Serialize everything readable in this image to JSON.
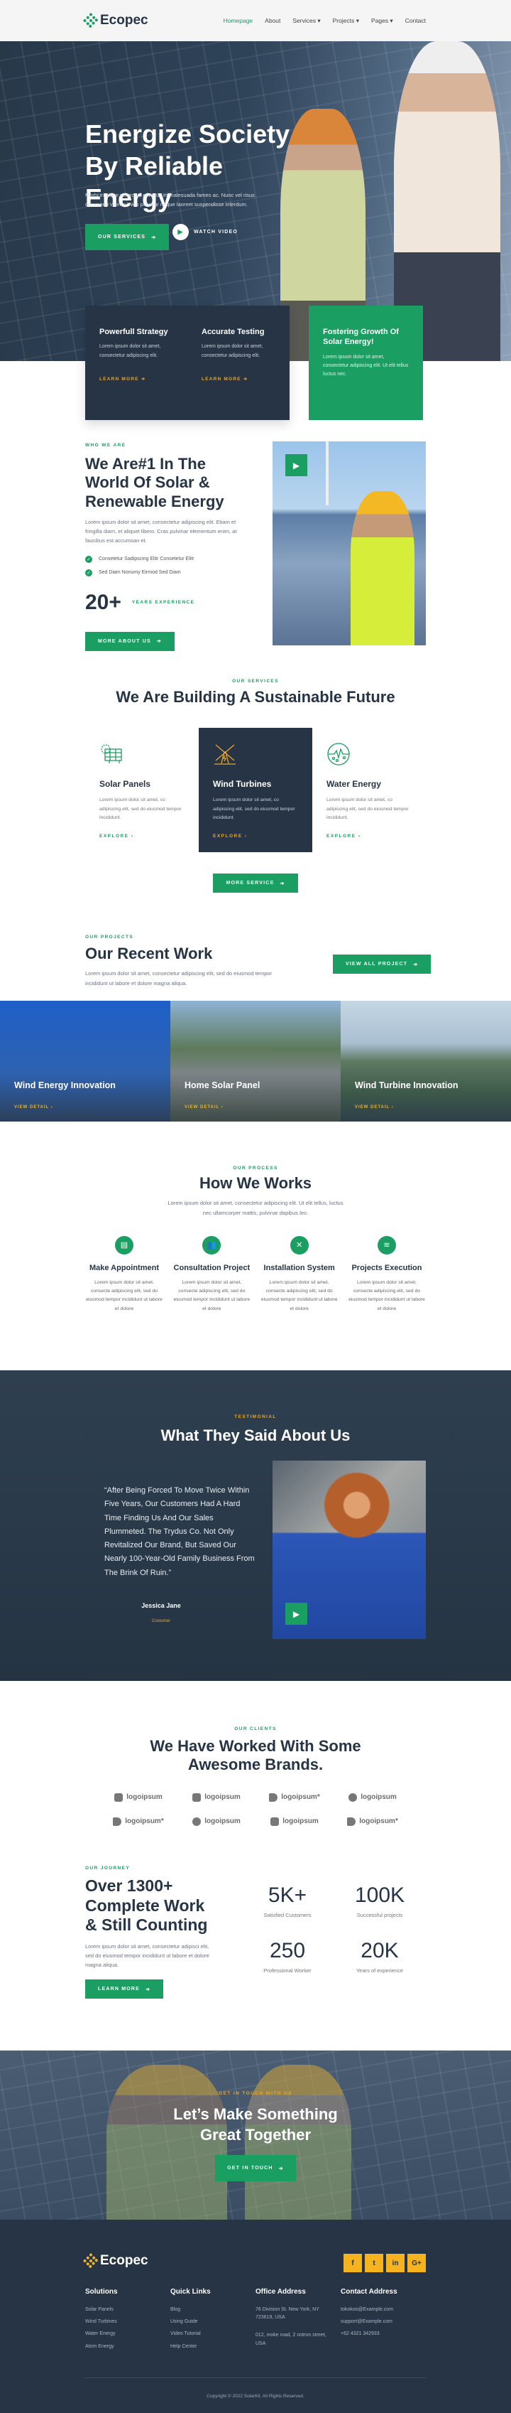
{
  "brand": "Ecopec",
  "colors": {
    "accent": "#1a9e62",
    "dark": "#263445",
    "highlight": "#f0b429"
  },
  "nav": {
    "items": [
      {
        "label": "Homepage",
        "active": true
      },
      {
        "label": "About"
      },
      {
        "label": "Services ▾"
      },
      {
        "label": "Projects ▾"
      },
      {
        "label": "Pages ▾"
      },
      {
        "label": "Contact"
      }
    ]
  },
  "hero": {
    "title": "Energize Society By Reliable Energy",
    "description": "Morbi tristique senectus et netus et malesuada fames ac. Nunc vel risus commodo viverra. Non pulvinar neque laoreet suspendisse interdum.",
    "services_button": "Our Services",
    "watch_video": "Watch Video"
  },
  "features": [
    {
      "title": "Powerfull Strategy",
      "text": "Lorem ipsum dolor sit amet, consectetur adipiscing elit.",
      "link": "Learn More"
    },
    {
      "title": "Accurate Testing",
      "text": "Lorem ipsum dolor sit amet, consectetur adipiscing elit.",
      "link": "Learn More"
    },
    {
      "title": "Fostering Growth Of Solar Energy!",
      "text": "Lorem ipsum dolor sit amet, consectetur adipiscing elit. Ut elit tellus luctus nec."
    }
  ],
  "about": {
    "eyebrow": "Who We Are",
    "title": "We Are#1 In The World Of Solar & Renewable Energy",
    "text": "Lorem ipsum dolor sit amet, consectetur adipiscing elit. Etiam et fringilla diam, et aliquet libero. Cras pulvinar elementum enim, at faucibus est accumsan et.",
    "checks": [
      "Consetetur Sadipscing Elitr Consetetur Elitr",
      "Sed Diam Nonumy Eirmod Sed Diam"
    ],
    "years": "20+",
    "years_label": "Years Experience",
    "button": "More About Us"
  },
  "services": {
    "eyebrow": "Our Services",
    "title": "We Are Building A Sustainable Future",
    "items": [
      {
        "icon": "solar-panel-icon",
        "title": "Solar Panels",
        "text": "Lorem ipsum dolor sit amet, co adipiscing elit, sed do eiusmod tempor incididunt.",
        "link": "Explore"
      },
      {
        "icon": "windmill-icon",
        "title": "Wind Turbines",
        "text": "Lorem ipsum dolor sit amet, co adipiscing elit, sed do eiusmod tempor incididunt.",
        "link": "Explore"
      },
      {
        "icon": "water-energy-icon",
        "title": "Water Energy",
        "text": "Lorem ipsum dolor sit amet, co adipiscing elit, sed do eiusmod tempor incididunt.",
        "link": "Explore"
      }
    ],
    "button": "More Service"
  },
  "projects": {
    "eyebrow": "Our Projects",
    "title": "Our Recent Work",
    "text": "Lorem ipsum dolor sit amet, consectetur adipiscing elit, sed do eiusmod tempor incididunt ut labore et dolore magna aliqua.",
    "button": "View All Project",
    "items": [
      {
        "title": "Wind Energy Innovation",
        "link": "View Detail"
      },
      {
        "title": "Home Solar Panel",
        "link": "View Detail"
      },
      {
        "title": "Wind Turbine Innovation",
        "link": "View Detail"
      }
    ]
  },
  "process": {
    "eyebrow": "Our Process",
    "title": "How We Works",
    "text": "Lorem ipsum dolor sit amet, consectetur adipiscing elit. Ut elit tellus, luctus nec ullamcorper mattis, pulvinar dapibus leo.",
    "steps": [
      {
        "icon": "book-icon",
        "title": "Make Appointment",
        "text": "Lorem ipsum dolor sit amet, consecte adipiscing elit, sed do eiusmod tempor incididunt ut labore et dolore"
      },
      {
        "icon": "users-icon",
        "title": "Consultation Project",
        "text": "Lorem ipsum dolor sit amet, consecte adipiscing elit, sed do eiusmod tempor incididunt ut labore et dolore"
      },
      {
        "icon": "tools-icon",
        "title": "Installation System",
        "text": "Lorem ipsum dolor sit amet, consecte adipiscing elit, sed do eiusmod tempor incididunt ut labore et dolore"
      },
      {
        "icon": "wind-icon",
        "title": "Projects Execution",
        "text": "Lorem ipsum dolor sit amet, consecte adipiscing elit, sed do eiusmod tempor incididunt ut labore et dolore"
      }
    ]
  },
  "testimonial": {
    "eyebrow": "Testimonial",
    "title": "What They Said About Us",
    "quote": "“After Being Forced To Move Twice Within Five Years, Our Customers Had A Hard Time Finding Us And Our Sales Plummeted. The Trydus Co. Not Only Revitalized Our Brand, But Saved Our Nearly 100-Year-Old Family Business From The Brink Of Ruin.”",
    "name": "Jessica Jane",
    "role": "Costumer"
  },
  "clients": {
    "eyebrow": "Our Clients",
    "title": "We Have Worked With Some Awesome Brands.",
    "logos": [
      "logoipsum",
      "logoipsum",
      "logoipsum*",
      "logoipsum",
      "logoipsum*",
      "logoipsum",
      "logoipsum",
      "logoipsum*"
    ]
  },
  "journey": {
    "eyebrow": "Our Journey",
    "title": "Over 1300+ Complete Work & Still Counting",
    "text": "Lorem ipsum dolor sit amet, consectetur adipisci elit, sed do eiusmod tempor incididunt ut labore et dolore magna aliqua.",
    "button": "Learn More",
    "stats": [
      {
        "value": "5K+",
        "label": "Satisfied Customers"
      },
      {
        "value": "100K",
        "label": "Successful projects"
      },
      {
        "value": "250",
        "label": "Professional Worker"
      },
      {
        "value": "20K",
        "label": "Years of experience"
      }
    ]
  },
  "cta": {
    "eyebrow": "Get In Touch With Us",
    "title": "Let’s Make Something Great Together",
    "button": "Get In Touch"
  },
  "footer": {
    "social": [
      "f",
      "t",
      "in",
      "G+"
    ],
    "columns": [
      {
        "title": "Solutions",
        "items": [
          "Solar Panels",
          "Wind Turbines",
          "Water Energy",
          "Atom Energy"
        ]
      },
      {
        "title": "Quick Links",
        "items": [
          "Blog",
          "Using Guide",
          "Video Tutorial",
          "Help Center"
        ]
      },
      {
        "title": "Office Address",
        "items": [
          "76 Division St. New York, NY 723619, USA",
          "012, moke road, 2 notron street, USA"
        ]
      },
      {
        "title": "Contact Address",
        "items": [
          "tokokoo@Example.com",
          "support@Example.com",
          "+62 4321 342933"
        ]
      }
    ],
    "copyright": "Copyright © 2022 SolarKit. All Rights Reserved."
  }
}
